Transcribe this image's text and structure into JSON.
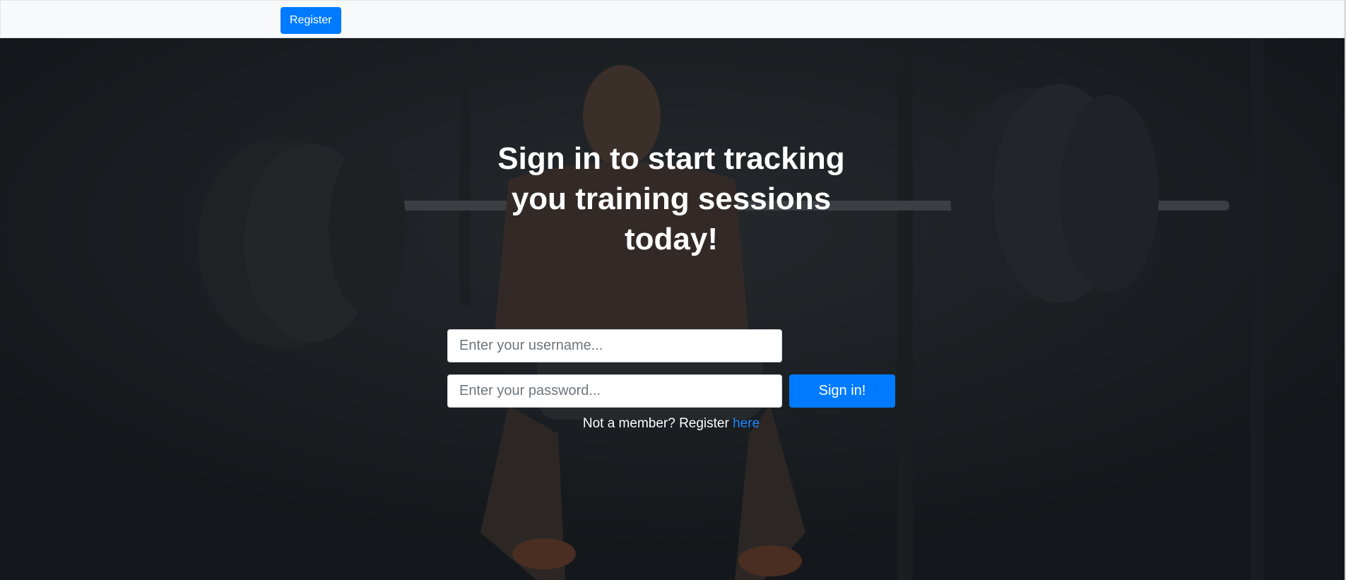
{
  "navbar": {
    "register_label": "Register"
  },
  "hero": {
    "headline": "Sign in to start tracking you training sessions today!",
    "background_image": "weightlifter-squat-photo"
  },
  "login_form": {
    "username_placeholder": "Enter your username...",
    "password_placeholder": "Enter your password...",
    "submit_label": "Sign in!"
  },
  "footer_prompt": {
    "text": "Not a member? Register ",
    "link_label": "here"
  },
  "colors": {
    "primary": "#007bff",
    "link": "#1e87ff",
    "navbar_bg": "#f8f9fa",
    "hero_bg": "#1b1e21"
  }
}
